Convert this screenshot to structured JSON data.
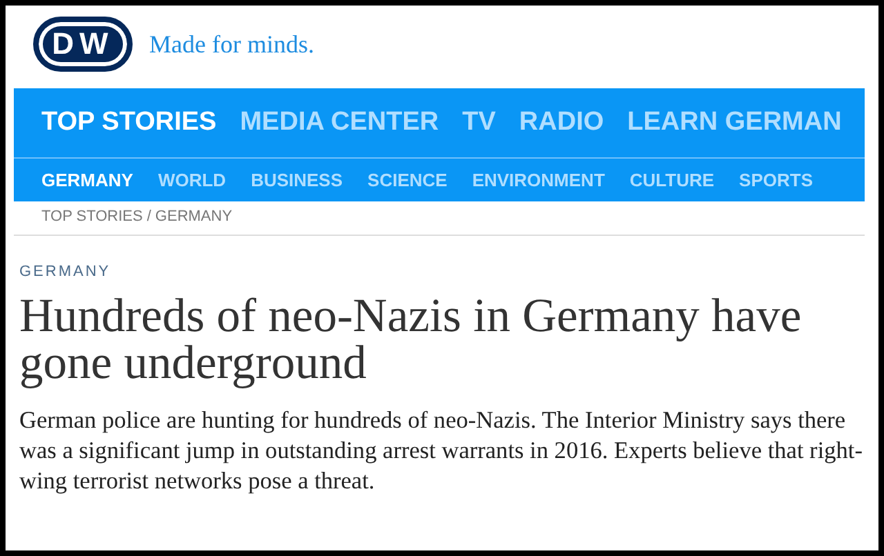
{
  "header": {
    "logo": "DW",
    "tagline": "Made for minds."
  },
  "main_nav": [
    {
      "label": "TOP STORIES",
      "selected": true
    },
    {
      "label": "MEDIA CENTER",
      "selected": false
    },
    {
      "label": "TV",
      "selected": false
    },
    {
      "label": "RADIO",
      "selected": false
    },
    {
      "label": "LEARN GERMAN",
      "selected": false
    }
  ],
  "sub_nav": [
    {
      "label": "GERMANY",
      "selected": true
    },
    {
      "label": "WORLD",
      "selected": false
    },
    {
      "label": "BUSINESS",
      "selected": false
    },
    {
      "label": "SCIENCE",
      "selected": false
    },
    {
      "label": "ENVIRONMENT",
      "selected": false
    },
    {
      "label": "CULTURE",
      "selected": false
    },
    {
      "label": "SPORTS",
      "selected": false
    }
  ],
  "breadcrumb": {
    "items": [
      "TOP STORIES",
      "GERMANY"
    ],
    "separator": "/"
  },
  "article": {
    "kicker": "GERMANY",
    "headline": "Hundreds of neo-Nazis in Germany have gone underground",
    "teaser": "German police are hunting for hundreds of neo-Nazis. The Interior Ministry says there was a significant jump in outstanding arrest warrants in 2016. Experts believe that right-wing terrorist networks pose a threat."
  }
}
